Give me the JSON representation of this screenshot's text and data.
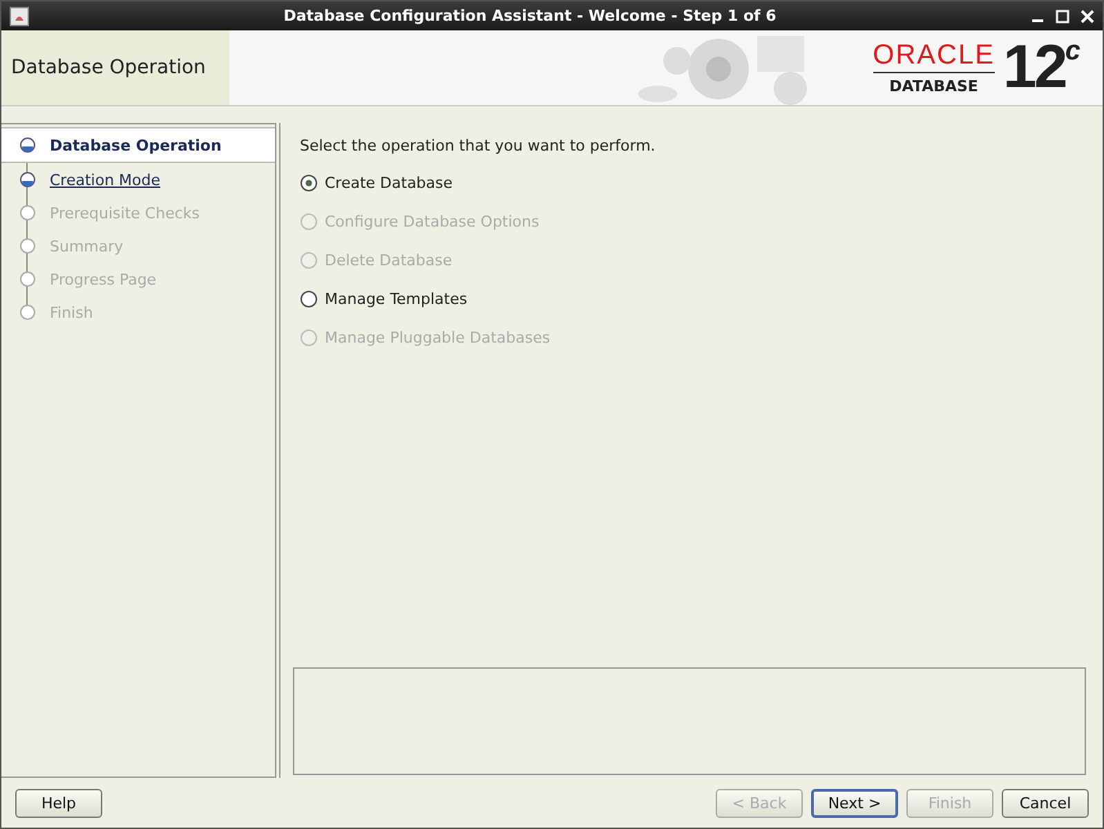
{
  "window": {
    "title": "Database Configuration Assistant - Welcome - Step 1 of 6"
  },
  "header": {
    "title": "Database Operation",
    "logo": {
      "brand": "ORACLE",
      "product": "DATABASE",
      "version": "12",
      "version_sup": "c"
    }
  },
  "steps": [
    {
      "label": "Database Operation",
      "selected": true,
      "disabled": false
    },
    {
      "label": "Creation Mode",
      "selected": false,
      "disabled": false
    },
    {
      "label": "Prerequisite Checks",
      "selected": false,
      "disabled": true
    },
    {
      "label": "Summary",
      "selected": false,
      "disabled": true
    },
    {
      "label": "Progress Page",
      "selected": false,
      "disabled": true
    },
    {
      "label": "Finish",
      "selected": false,
      "disabled": true
    }
  ],
  "prompt": "Select the operation that you want to perform.",
  "options": [
    {
      "label": "Create Database",
      "selected": true,
      "disabled": false
    },
    {
      "label": "Configure Database Options",
      "selected": false,
      "disabled": true
    },
    {
      "label": "Delete Database",
      "selected": false,
      "disabled": true
    },
    {
      "label": "Manage Templates",
      "selected": false,
      "disabled": false
    },
    {
      "label": "Manage Pluggable Databases",
      "selected": false,
      "disabled": true
    }
  ],
  "help_button": "Help",
  "buttons": [
    {
      "label": "< Back",
      "disabled": true,
      "default": false
    },
    {
      "label": "Next >",
      "disabled": false,
      "default": true
    },
    {
      "label": "Finish",
      "disabled": true,
      "default": false
    },
    {
      "label": "Cancel",
      "disabled": false,
      "default": false
    }
  ]
}
